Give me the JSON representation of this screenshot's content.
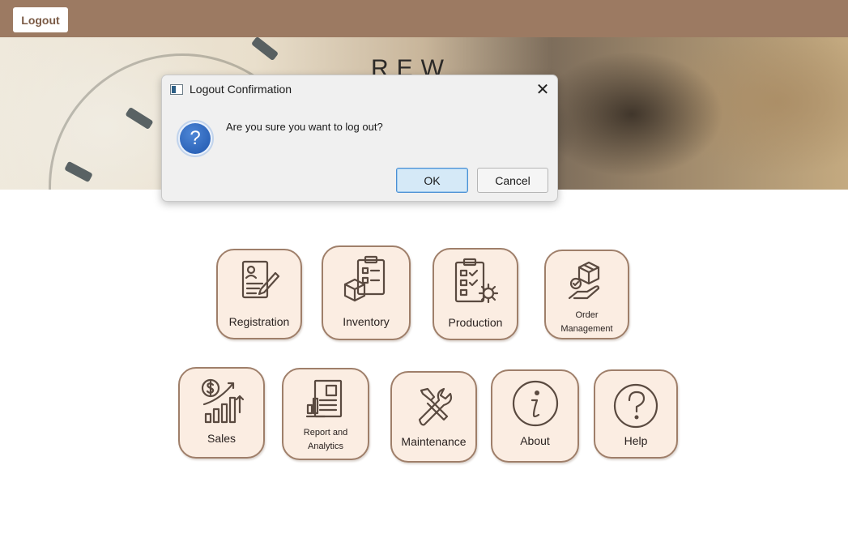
{
  "topbar": {
    "logout_label": "Logout",
    "color": "#9c7a62"
  },
  "banner": {
    "logo_text": "REW"
  },
  "dialog": {
    "title": "Logout Confirmation",
    "close_glyph": "✕",
    "icon": "question-icon",
    "question_glyph": "?",
    "message": "Are you sure you want to log out?",
    "ok_label": "OK",
    "cancel_label": "Cancel"
  },
  "modules": {
    "registration": {
      "label": "Registration",
      "icon": "registration-form-icon"
    },
    "inventory": {
      "label": "Inventory",
      "icon": "inventory-clipboard-box-icon"
    },
    "production": {
      "label": "Production",
      "icon": "production-checklist-gear-icon"
    },
    "order": {
      "label_1": "Order",
      "label_2": "Management",
      "icon": "order-box-hand-icon"
    },
    "sales": {
      "label": "Sales",
      "icon": "sales-dollar-chart-icon"
    },
    "report": {
      "label_1": "Report and",
      "label_2": "Analytics",
      "icon": "report-analytics-icon"
    },
    "maintenance": {
      "label": "Maintenance",
      "icon": "wrench-screwdriver-icon"
    },
    "about": {
      "label": "About",
      "icon": "info-icon"
    },
    "help": {
      "label": "Help",
      "icon": "help-question-icon"
    }
  },
  "colors": {
    "tile_bg": "#fbede2",
    "tile_border": "#9f7f6a",
    "dialog_bg": "#f0f0f0",
    "ok_bg": "#d5e9f7"
  }
}
